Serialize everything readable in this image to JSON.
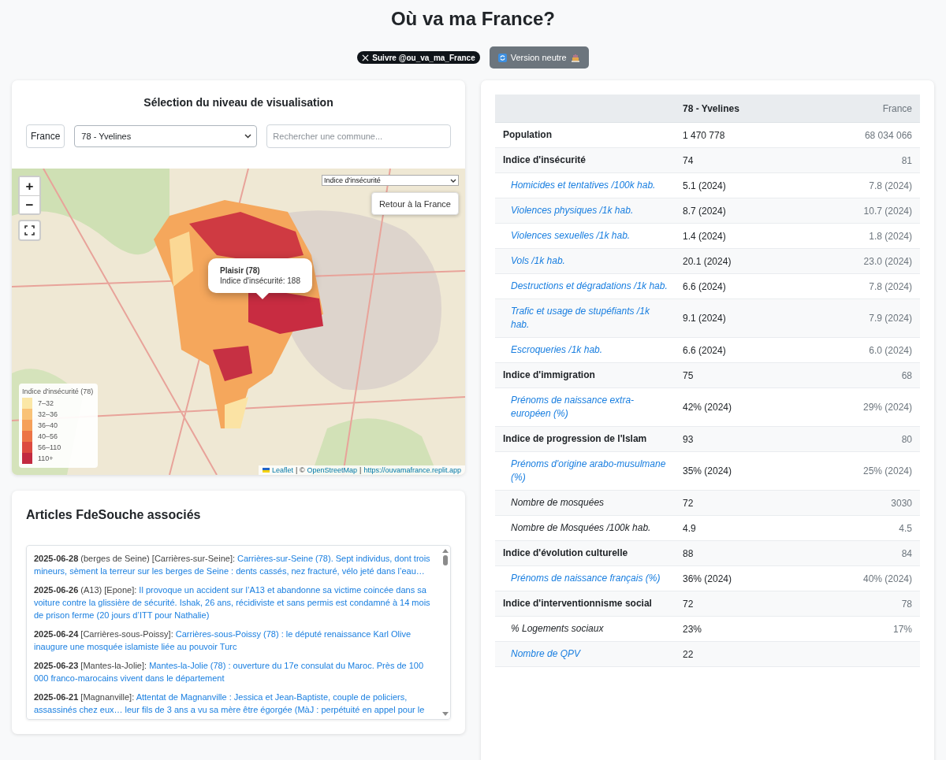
{
  "title": "Où va ma France?",
  "header_buttons": [
    {
      "kind": "follow",
      "label": "Suivre @ou_va_ma_France"
    },
    {
      "kind": "neutral",
      "label": "Version neutre"
    }
  ],
  "selection": {
    "title": "Sélection du niveau de visualisation",
    "level_button": "France",
    "department_select": "78 - Yvelines",
    "search": {
      "placeholder": "Rechercher une commune..."
    }
  },
  "map": {
    "kind": "picture",
    "indicator_select": "Indice d'insécurité",
    "zoom_in": "+",
    "zoom_out": "−",
    "reset_button": "Retour à la France",
    "popup": {
      "title": "Plaisir (78)",
      "text": "Indice d'insécurité: 188"
    },
    "legend": {
      "title": "Indice d'insécurité (78)",
      "items": [
        {
          "label": "7–32",
          "color": "#fbe7a6"
        },
        {
          "label": "32–36",
          "color": "#f9c277"
        },
        {
          "label": "36–40",
          "color": "#f5a059"
        },
        {
          "label": "40–56",
          "color": "#ec7446"
        },
        {
          "label": "56–110",
          "color": "#dc4a3f"
        },
        {
          "label": "110+",
          "color": "#c22a40"
        }
      ]
    },
    "attribution": [
      {
        "text": "Leaflet",
        "link": true
      },
      {
        "text": "| ©",
        "link": false
      },
      {
        "text": "OpenStreetMap",
        "link": true
      },
      {
        "text": "|",
        "link": false
      },
      {
        "text": "https://ouvamafrance.replit.app",
        "link": true
      }
    ]
  },
  "articles": {
    "title": "Articles FdeSouche associés",
    "items": [
      {
        "date": "2025-06-28",
        "place": "(berges de Seine)",
        "location": "[Carrières-sur-Seine]:",
        "headline": "Carrières-sur-Seine (78). Sept individus, dont trois mineurs, sèment la terreur sur les berges de Seine : dents cassés, nez fracturé, vélo jeté dans l’eau…"
      },
      {
        "date": "2025-06-26",
        "place": "(A13)",
        "location": "[Epone]:",
        "headline": "Il provoque un accident sur l’A13 et abandonne sa victime coincée dans sa voiture contre la glissière de sécurité. Ishak, 26 ans, récidiviste et sans permis est condamné à 14 mois de prison ferme (20 jours d’ITT pour Nathalie)"
      },
      {
        "date": "2025-06-24",
        "location": "[Carrières-sous-Poissy]:",
        "headline": "Carrières-sous-Poissy (78) : le député renaissance Karl Olive inaugure une mosquée islamiste liée au pouvoir Turc"
      },
      {
        "date": "2025-06-23",
        "location": "[Mantes-la-Jolie]:",
        "headline": "Mantes-la-Jolie (78) : ouverture du 17e consulat du Maroc. Près de 100 000 franco-marocains vivent dans le département"
      },
      {
        "date": "2025-06-21",
        "location": "[Magnanville]:",
        "headline": "Attentat de Magnanville : Jessica et Jean-Baptiste, couple de policiers, assassinés chez eux… leur fils de 3 ans a vu sa mère être égorgée (MàJ : perpétuité en appel pour le"
      }
    ]
  },
  "table": {
    "columns": [
      "78 - Yvelines",
      "France"
    ],
    "rows": [
      {
        "kind": "plain",
        "label": "Population",
        "local": "1 470 778",
        "national": "68 034 066"
      },
      {
        "kind": "index",
        "label": "Indice d'insécurité",
        "local": "74",
        "national": "81"
      },
      {
        "kind": "link",
        "label": "Homicides et tentatives /100k hab.",
        "local": "5.1 (2024)",
        "national": "7.8 (2024)"
      },
      {
        "kind": "link",
        "label": "Violences physiques /1k hab.",
        "local": "8.7 (2024)",
        "national": "10.7 (2024)"
      },
      {
        "kind": "link",
        "label": "Violences sexuelles /1k hab.",
        "local": "1.4 (2024)",
        "national": "1.8 (2024)"
      },
      {
        "kind": "link",
        "label": "Vols /1k hab.",
        "local": "20.1 (2024)",
        "national": "23.0 (2024)"
      },
      {
        "kind": "link",
        "label": "Destructions et dégradations /1k hab.",
        "local": "6.6 (2024)",
        "national": "7.8 (2024)"
      },
      {
        "kind": "link",
        "label": "Trafic et usage de stupéfiants /1k hab.",
        "local": "9.1 (2024)",
        "national": "7.9 (2024)"
      },
      {
        "kind": "link",
        "label": "Escroqueries /1k hab.",
        "local": "6.6 (2024)",
        "national": "6.0 (2024)"
      },
      {
        "kind": "index",
        "label": "Indice d'immigration",
        "local": "75",
        "national": "68"
      },
      {
        "kind": "link",
        "label": "Prénoms de naissance extra-européen (%)",
        "local": "42% (2024)",
        "national": "29% (2024)"
      },
      {
        "kind": "index",
        "label": "Indice de progression de l'Islam",
        "local": "93",
        "national": "80"
      },
      {
        "kind": "link",
        "label": "Prénoms d'origine arabo-musulmane (%)",
        "local": "35% (2024)",
        "national": "25% (2024)"
      },
      {
        "kind": "sub",
        "label": "Nombre de mosquées",
        "local": "72",
        "national": "3030"
      },
      {
        "kind": "sub",
        "label": "Nombre de Mosquées /100k hab.",
        "local": "4.9",
        "national": "4.5"
      },
      {
        "kind": "index",
        "label": "Indice d'évolution culturelle",
        "local": "88",
        "national": "84"
      },
      {
        "kind": "link",
        "label": "Prénoms de naissance français (%)",
        "local": "36% (2024)",
        "national": "40% (2024)"
      },
      {
        "kind": "index",
        "label": "Indice d'interventionnisme social",
        "local": "72",
        "national": "78"
      },
      {
        "kind": "sub",
        "label": "% Logements sociaux",
        "local": "23%",
        "national": "17%"
      },
      {
        "kind": "link",
        "label": "Nombre de QPV",
        "local": "22"
      }
    ]
  }
}
